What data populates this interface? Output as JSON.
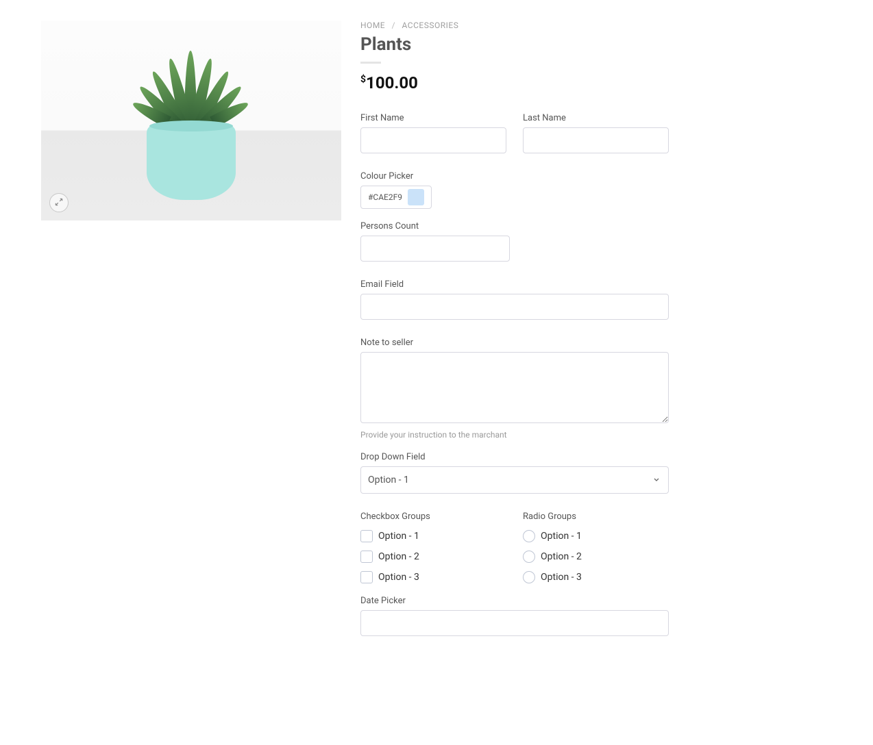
{
  "breadcrumb": {
    "home": "HOME",
    "category": "ACCESSORIES"
  },
  "product": {
    "title": "Plants",
    "currency": "$",
    "price": "100.00"
  },
  "form": {
    "first_name": {
      "label": "First Name",
      "value": ""
    },
    "last_name": {
      "label": "Last Name",
      "value": ""
    },
    "colour_picker": {
      "label": "Colour Picker",
      "value": "#CAE2F9"
    },
    "persons_count": {
      "label": "Persons Count",
      "value": ""
    },
    "email": {
      "label": "Email Field",
      "value": ""
    },
    "note": {
      "label": "Note to seller",
      "value": "",
      "helper": "Provide your instruction to the marchant"
    },
    "dropdown": {
      "label": "Drop Down Field",
      "selected": "Option - 1"
    },
    "checkbox_group": {
      "label": "Checkbox Groups",
      "options": [
        "Option - 1",
        "Option - 2",
        "Option - 3"
      ]
    },
    "radio_group": {
      "label": "Radio Groups",
      "options": [
        "Option - 1",
        "Option - 2",
        "Option - 3"
      ]
    },
    "date_picker": {
      "label": "Date Picker",
      "value": ""
    }
  },
  "colors": {
    "swatch": "#CAE2F9"
  }
}
